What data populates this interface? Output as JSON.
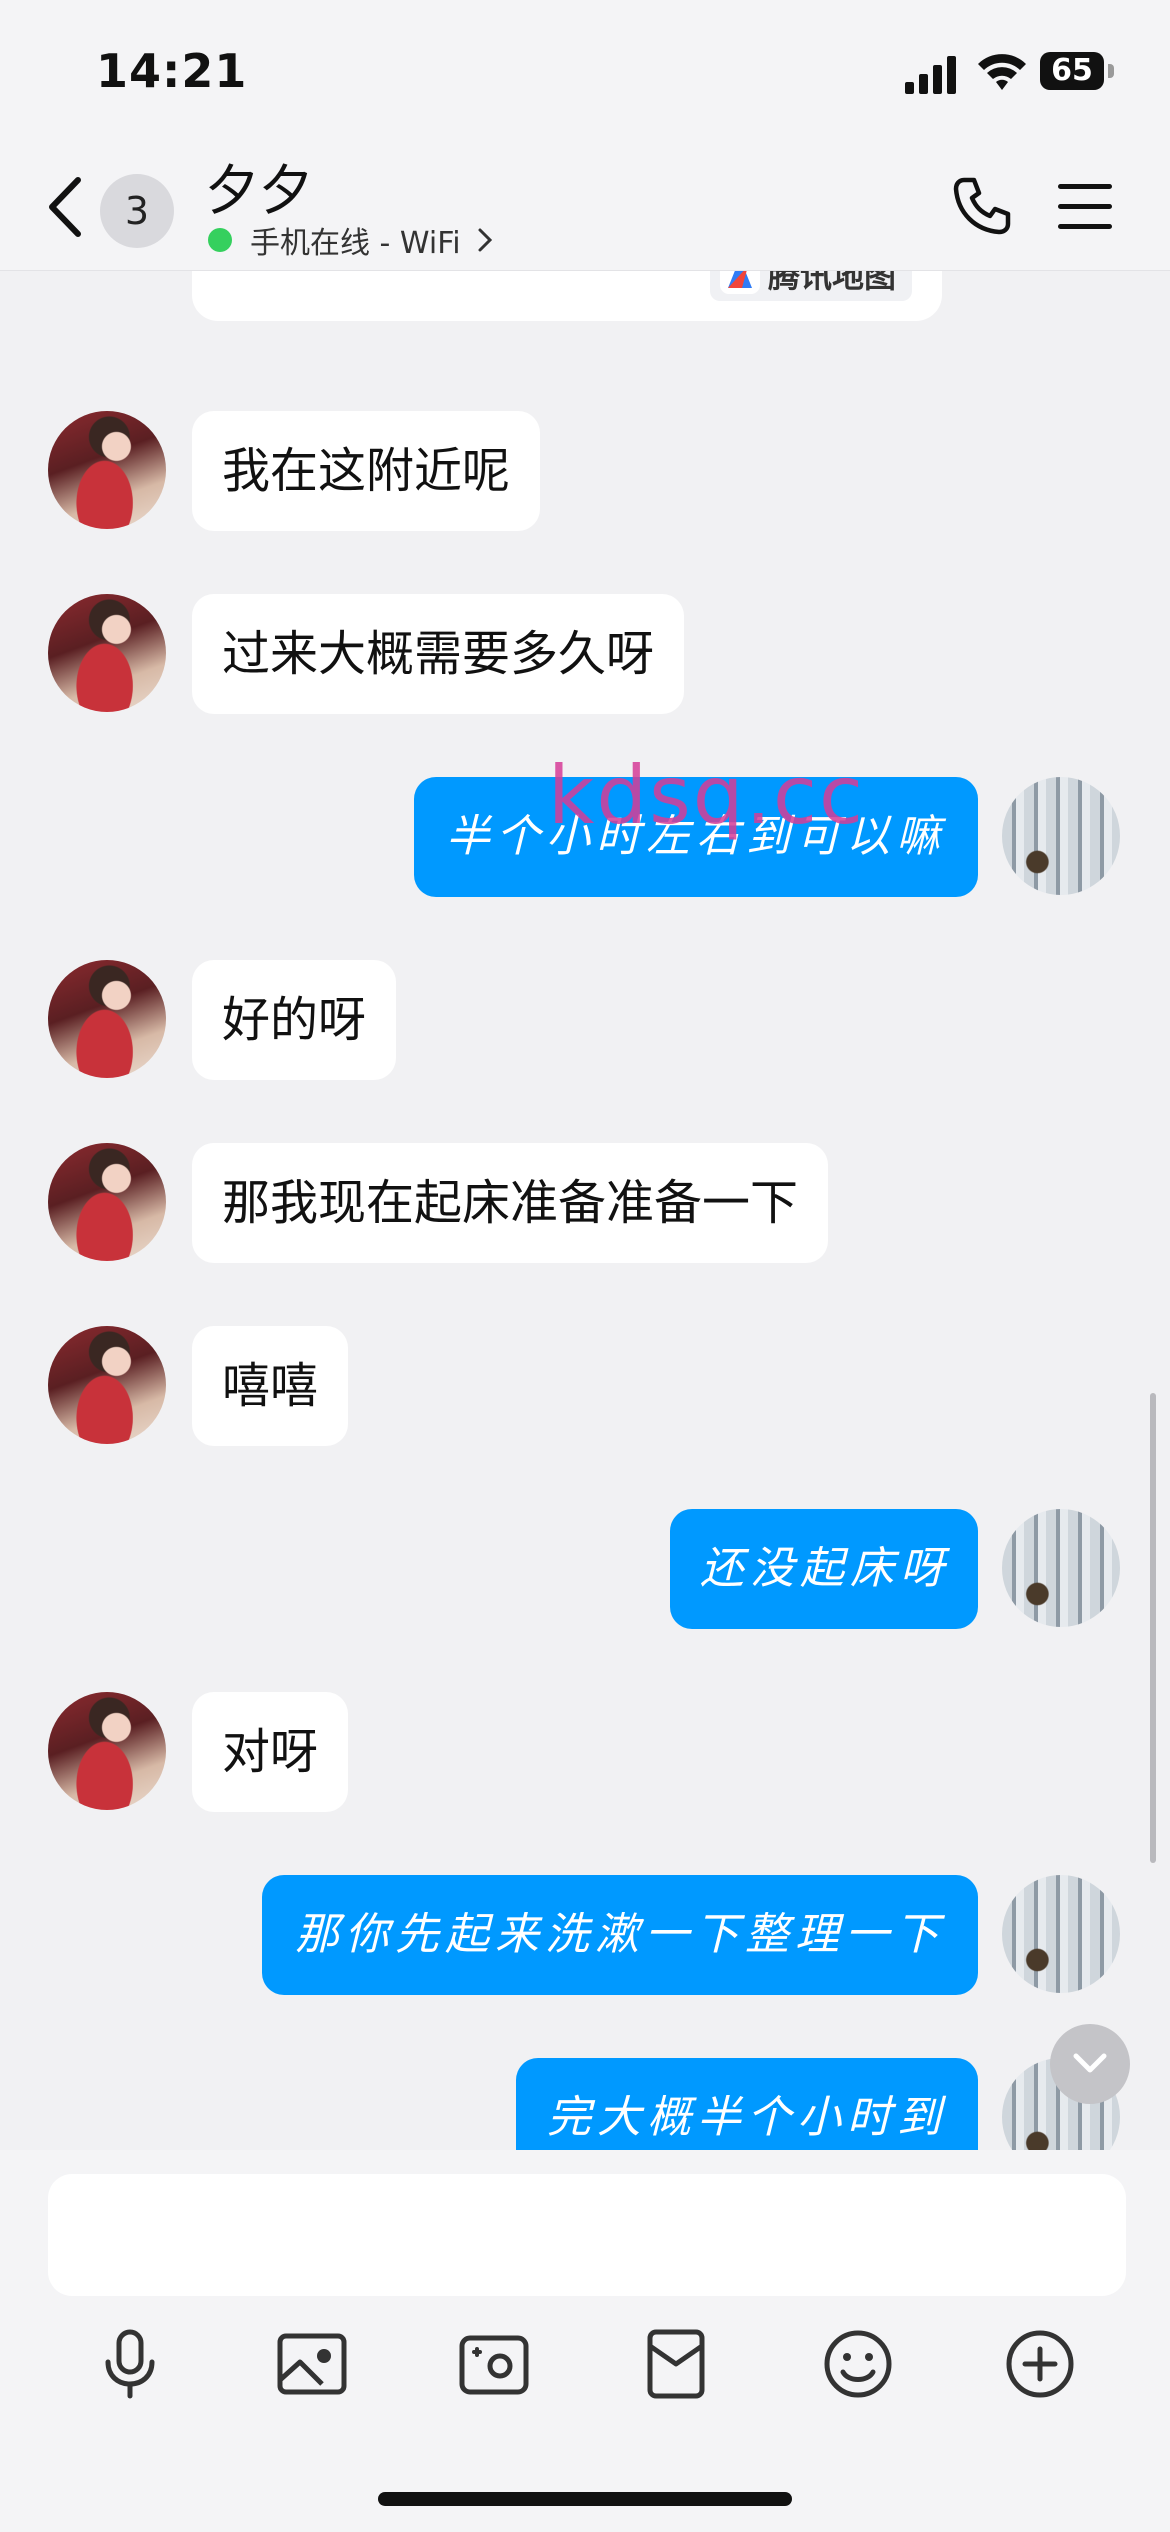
{
  "status_bar": {
    "time": "14:21",
    "battery": "65"
  },
  "header": {
    "unread_count": "3",
    "contact_name": "夕夕",
    "presence": "手机在线 - WiFi"
  },
  "map_card": {
    "provider": "腾讯地图"
  },
  "messages": [
    {
      "side": "in",
      "text": "我在这附近呢"
    },
    {
      "side": "in",
      "text": "过来大概需要多久呀"
    },
    {
      "side": "out",
      "text": "半个小时左右到可以嘛"
    },
    {
      "side": "in",
      "text": "好的呀"
    },
    {
      "side": "in",
      "text": "那我现在起床准备准备一下"
    },
    {
      "side": "in",
      "text": "嘻嘻"
    },
    {
      "side": "out",
      "text": "还没起床呀"
    },
    {
      "side": "in",
      "text": "对呀"
    },
    {
      "side": "out",
      "text": "那你先起来洗漱一下整理一下"
    },
    {
      "side": "out",
      "text": "完大概半个小时到"
    }
  ],
  "watermark": "kdsq.cc",
  "composer": {
    "placeholder": ""
  },
  "toolbar_icons": [
    "mic-icon",
    "image-icon",
    "camera-icon",
    "red-packet-icon",
    "emoji-icon",
    "plus-icon"
  ],
  "colors": {
    "outgoing_bubble": "#0099ff",
    "incoming_bubble": "#ffffff",
    "online_dot": "#35d05e"
  }
}
